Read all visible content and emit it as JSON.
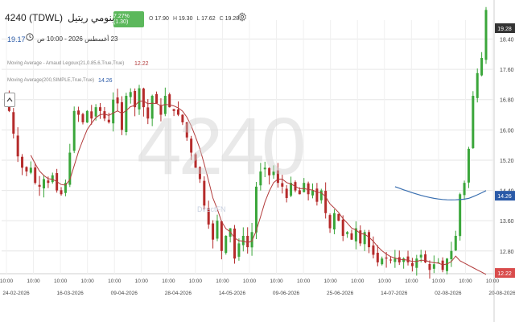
{
  "header": {
    "symbol": "4240 (TDWL)",
    "company": "سينومي ريتيل",
    "change_badge": "7.27%(1.30)",
    "ohlc": [
      {
        "key": "O",
        "value": "17.90"
      },
      {
        "key": "H",
        "value": "19.30"
      },
      {
        "key": "L",
        "value": "17.62"
      },
      {
        "key": "C",
        "value": "19.28"
      }
    ],
    "settings_icon": "gear-icon"
  },
  "info": {
    "last_price": "19.17",
    "timestamp": "23 أغسطس 2026 - 10:00 ص",
    "clock_icon": "clock-icon"
  },
  "indicators": [
    {
      "label": "Moving Average - Arnaud Legoux(21,0.85,6,True,True)",
      "value": "12.22",
      "color": "#b23b3b"
    },
    {
      "label": "Moving Average(200,SIMPLE,True,True)",
      "value": "14.26",
      "color": "#2a5aa8"
    }
  ],
  "watermark": "4240",
  "watermark_sub": "DirectFN",
  "price_axis": {
    "ticks": [
      "18.40",
      "17.60",
      "16.80",
      "16.00",
      "15.20",
      "14.40",
      "13.60",
      "12.80"
    ],
    "labels": [
      {
        "text": "19.28",
        "kind": "last-close",
        "color": "#333333"
      },
      {
        "text": "14.26",
        "kind": "ma200",
        "color": "#2a5aa8"
      },
      {
        "text": "12.22",
        "kind": "alma",
        "color": "#d94c4c"
      }
    ]
  },
  "time_axis": [
    {
      "time": "10:00",
      "date": "24-02-2026"
    },
    {
      "time": "10:00",
      "date": ""
    },
    {
      "time": "10:00",
      "date": "16-03-2026"
    },
    {
      "time": "10:00",
      "date": ""
    },
    {
      "time": "10:00",
      "date": "09-04-2026"
    },
    {
      "time": "10:00",
      "date": ""
    },
    {
      "time": "10:00",
      "date": "28-04-2026"
    },
    {
      "time": "10:00",
      "date": ""
    },
    {
      "time": "10:00",
      "date": "14-05-2026"
    },
    {
      "time": "10:00",
      "date": ""
    },
    {
      "time": "10:00",
      "date": "09-06-2026"
    },
    {
      "time": "10:00",
      "date": ""
    },
    {
      "time": "10:00",
      "date": "25-06-2026"
    },
    {
      "time": "10:00",
      "date": ""
    },
    {
      "time": "10:00",
      "date": "14-07-2026"
    },
    {
      "time": "10:00",
      "date": ""
    },
    {
      "time": "10:00",
      "date": "02-08-2026"
    },
    {
      "time": "10:00",
      "date": ""
    },
    {
      "time": "10:00",
      "date": "20-08-2026"
    }
  ],
  "colors": {
    "up": "#3aa63a",
    "down": "#b52b2b",
    "alma": "#b23b3b",
    "ma200": "#3a6fb0",
    "grid": "#e6e6e6",
    "badge": "#5cb85c"
  },
  "chart_data": {
    "type": "candlestick",
    "ylim": [
      12.2,
      18.9
    ],
    "x_dates": [
      "24-02-2026",
      "16-03-2026",
      "09-04-2026",
      "28-04-2026",
      "14-05-2026",
      "09-06-2026",
      "25-06-2026",
      "14-07-2026",
      "02-08-2026",
      "20-08-2026"
    ],
    "close_points": [
      [
        0,
        16.9
      ],
      [
        1,
        16.5
      ],
      [
        2,
        15.9
      ],
      [
        3,
        15.3
      ],
      [
        4,
        15.0
      ],
      [
        5,
        14.9
      ],
      [
        6,
        15.0
      ],
      [
        7,
        14.6
      ],
      [
        8,
        14.5
      ],
      [
        9,
        14.7
      ],
      [
        10,
        14.6
      ],
      [
        11,
        14.8
      ],
      [
        12,
        14.4
      ],
      [
        13,
        14.3
      ],
      [
        14,
        14.6
      ],
      [
        15,
        15.4
      ],
      [
        16,
        16.5
      ],
      [
        17,
        16.4
      ],
      [
        18,
        16.2
      ],
      [
        19,
        16.5
      ],
      [
        20,
        16.3
      ],
      [
        21,
        16.6
      ],
      [
        22,
        16.5
      ],
      [
        23,
        16.3
      ],
      [
        24,
        16.2
      ],
      [
        25,
        16.8
      ],
      [
        26,
        16.7
      ],
      [
        27,
        16.0
      ],
      [
        28,
        16.9
      ],
      [
        29,
        17.0
      ],
      [
        30,
        16.6
      ],
      [
        31,
        17.1
      ],
      [
        32,
        16.6
      ],
      [
        33,
        16.3
      ],
      [
        34,
        16.9
      ],
      [
        35,
        16.7
      ],
      [
        36,
        16.4
      ],
      [
        37,
        16.9
      ],
      [
        38,
        16.6
      ],
      [
        39,
        16.5
      ],
      [
        40,
        16.4
      ],
      [
        41,
        16.2
      ],
      [
        42,
        15.8
      ],
      [
        43,
        15.4
      ],
      [
        44,
        15.0
      ],
      [
        45,
        14.7
      ],
      [
        46,
        14.0
      ],
      [
        47,
        13.5
      ],
      [
        48,
        13.1
      ],
      [
        49,
        13.6
      ],
      [
        50,
        12.8
      ],
      [
        51,
        13.2
      ],
      [
        52,
        13.4
      ],
      [
        53,
        12.6
      ],
      [
        54,
        13.0
      ],
      [
        55,
        13.2
      ],
      [
        56,
        12.9
      ],
      [
        57,
        13.3
      ],
      [
        58,
        14.5
      ],
      [
        59,
        14.9
      ],
      [
        60,
        15.0
      ],
      [
        61,
        14.8
      ],
      [
        62,
        14.9
      ],
      [
        63,
        14.6
      ],
      [
        64,
        14.5
      ],
      [
        65,
        14.2
      ],
      [
        66,
        14.6
      ],
      [
        67,
        14.4
      ],
      [
        68,
        14.3
      ],
      [
        69,
        14.6
      ],
      [
        70,
        14.3
      ],
      [
        71,
        14.4
      ],
      [
        72,
        14.1
      ],
      [
        73,
        14.4
      ],
      [
        74,
        13.8
      ],
      [
        75,
        13.4
      ],
      [
        76,
        13.8
      ],
      [
        77,
        13.6
      ],
      [
        78,
        13.2
      ],
      [
        79,
        13.3
      ],
      [
        80,
        13.1
      ],
      [
        81,
        13.4
      ],
      [
        82,
        13.0
      ],
      [
        83,
        13.3
      ],
      [
        84,
        12.9
      ],
      [
        85,
        12.7
      ],
      [
        86,
        12.5
      ],
      [
        87,
        12.6
      ],
      [
        88,
        12.6
      ],
      [
        89,
        12.55
      ],
      [
        90,
        12.6
      ],
      [
        91,
        12.5
      ],
      [
        92,
        12.6
      ],
      [
        93,
        12.5
      ],
      [
        94,
        12.4
      ],
      [
        95,
        12.6
      ],
      [
        96,
        12.7
      ],
      [
        97,
        12.5
      ],
      [
        98,
        12.3
      ],
      [
        99,
        12.45
      ],
      [
        100,
        12.5
      ],
      [
        101,
        12.3
      ],
      [
        102,
        12.6
      ],
      [
        103,
        12.8
      ],
      [
        104,
        13.2
      ],
      [
        105,
        14.3
      ],
      [
        106,
        14.6
      ],
      [
        107,
        15.5
      ],
      [
        108,
        16.9
      ],
      [
        109,
        17.5
      ],
      [
        110,
        17.9
      ],
      [
        111,
        19.17
      ]
    ]
  }
}
